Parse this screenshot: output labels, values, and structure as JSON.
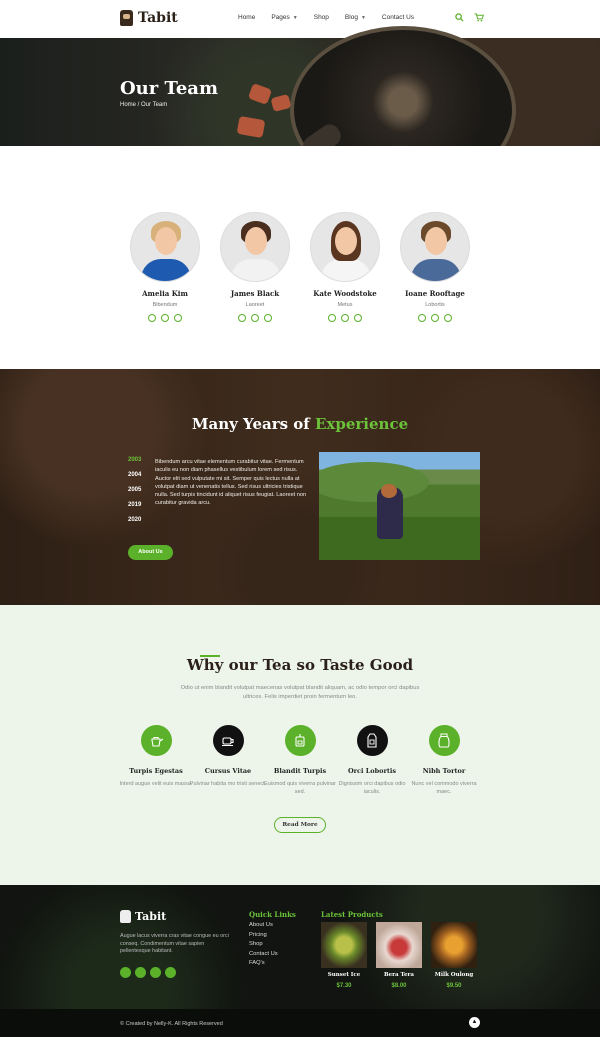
{
  "header": {
    "logo_text": "Tabit",
    "nav": [
      {
        "label": "Home",
        "dropdown": false
      },
      {
        "label": "Pages",
        "dropdown": true
      },
      {
        "label": "Shop",
        "dropdown": false
      },
      {
        "label": "Blog",
        "dropdown": true
      },
      {
        "label": "Contact Us",
        "dropdown": false
      }
    ],
    "icons": [
      "search-icon",
      "cart-icon"
    ]
  },
  "hero": {
    "title": "Our Team",
    "breadcrumb": "Home / Our Team"
  },
  "team": [
    {
      "name": "Amelia Kim",
      "role": "Bibendum",
      "hair": "#d8b07a",
      "shirt": "#1e5bb0"
    },
    {
      "name": "James Black",
      "role": "Laoreet",
      "hair": "#4a2f1f",
      "shirt": "#f2f2f2"
    },
    {
      "name": "Kate Woodstoke",
      "role": "Metus",
      "hair": "#5a3520",
      "shirt": "#f5f5f5"
    },
    {
      "name": "Ioane Rooftage",
      "role": "Lobortis",
      "hair": "#6a4a2a",
      "shirt": "#4a6a9a"
    }
  ],
  "experience": {
    "title_main": "Many Years of",
    "title_highlight": "Experience",
    "years": [
      "2003",
      "2004",
      "2005",
      "2019",
      "2020"
    ],
    "text": "Bibendum arcu vitae elementum curabitur vitae. Fermentum iaculis eu non diam phasellus vestibulum lorem sed risus. Auctor elit sed vulputate mi sit. Semper quis lectus nulla at volutpat diam ut venenatis tellus. Sed risus ultricies tristique nulla. Sed turpis tincidunt id aliquet risus feugiat. Laoreet non curabitur gravida arcu.",
    "button": "About Us"
  },
  "why": {
    "title": "Why our Tea so Taste Good",
    "subtitle": "Odio ut enim blandit volutpat maecenas volutpat blandit aliquam, ac odio tempor orci dapibus ultrices. Felis imperdiet proin fermentum leo.",
    "features": [
      {
        "title": "Turpis Egestas",
        "desc": "Interd augue velit euis massa.",
        "icon": "teapot-icon",
        "bg": "#5bb12a"
      },
      {
        "title": "Cursus Vitae",
        "desc": "Pulvinar habita mo tristi senect.",
        "icon": "teacup-icon",
        "bg": "#111111"
      },
      {
        "title": "Blandit Turpis",
        "desc": "Euismod quis viverra pulvinar sed.",
        "icon": "tea-bag-icon",
        "bg": "#5bb12a"
      },
      {
        "title": "Orci Lobortis",
        "desc": "Dignissim orci dapibus odio iaculis.",
        "icon": "tea-box-icon",
        "bg": "#111111"
      },
      {
        "title": "Nibh Tortor",
        "desc": "Nunc vel commodo viverra maec.",
        "icon": "tea-jar-icon",
        "bg": "#5bb12a"
      }
    ],
    "button": "Read More"
  },
  "footer": {
    "logo_text": "Tabit",
    "about": "Augue lacus viverra cras vitae congue eu orci conseq. Condimentum vitae sapien pellentesque habitant.",
    "quick_links_title": "Quick Links",
    "quick_links": [
      "About Us",
      "Pricing",
      "Shop",
      "Contact Us",
      "FAQ's"
    ],
    "products_title": "Latest Products",
    "products": [
      {
        "name": "Sunset Ice",
        "price": "$7.30",
        "color": "#6a8a2a"
      },
      {
        "name": "Bera Tera",
        "price": "$8.00",
        "color": "#b02a2a"
      },
      {
        "name": "Milk Oulong",
        "price": "$9.50",
        "color": "#c8802a"
      }
    ],
    "copyright": "© Created by Nelly-K. All Rights Reserved"
  },
  "colors": {
    "accent": "#5bb12a",
    "dark": "#111111"
  }
}
